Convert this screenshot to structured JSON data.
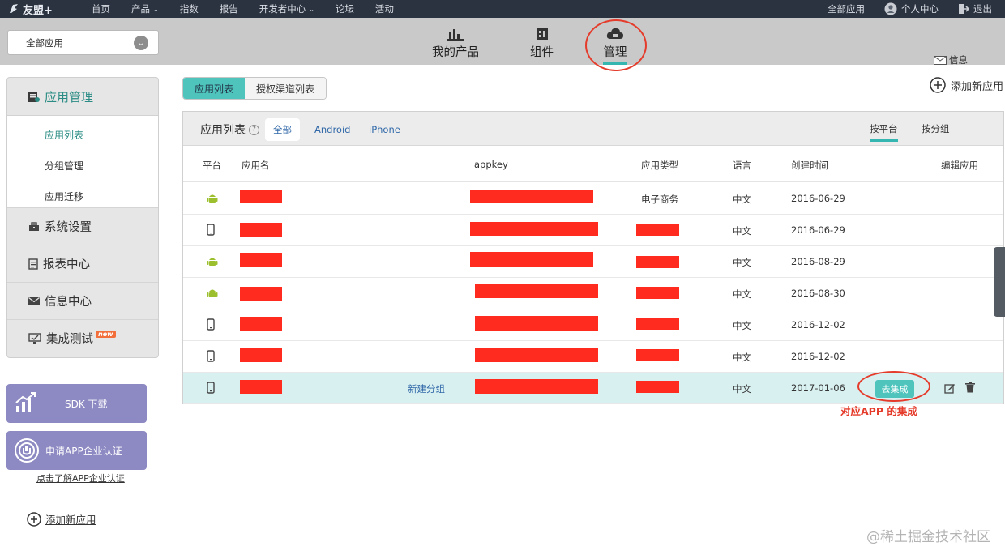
{
  "topnav": {
    "logo": "友盟+",
    "items": [
      {
        "label": "首页"
      },
      {
        "label": "产品",
        "caret": "⌄"
      },
      {
        "label": "指数"
      },
      {
        "label": "报告"
      },
      {
        "label": "开发者中心",
        "caret": "⌄"
      },
      {
        "label": "论坛"
      },
      {
        "label": "活动"
      }
    ],
    "right": {
      "all_apps": "全部应用",
      "personal_center": "个人中心",
      "logout": "退出"
    }
  },
  "subbar": {
    "app_select_value": "全部应用",
    "tabs": {
      "products": "我的产品",
      "components": "组件",
      "manage": "管理"
    },
    "message": "信息"
  },
  "sidebar": {
    "header": "应用管理",
    "subitems": [
      "应用列表",
      "分组管理",
      "应用迁移"
    ],
    "sections": [
      "系统设置",
      "报表中心",
      "信息中心",
      "集成测试"
    ],
    "new_badge": "new",
    "sdk_download": "SDK 下载",
    "enterprise_cert": "申请APP企业认证",
    "cert_link": "点击了解APP企业认证",
    "add_app": "添加新应用"
  },
  "main": {
    "segments": [
      "应用列表",
      "授权渠道列表"
    ],
    "add_app": "添加新应用",
    "panel": {
      "title": "应用列表",
      "help": "?",
      "filters": [
        "全部",
        "Android",
        "iPhone"
      ],
      "sorts": [
        "按平台",
        "按分组"
      ],
      "columns": {
        "platform": "平台",
        "app_name": "应用名",
        "appkey": "appkey",
        "app_type": "应用类型",
        "language": "语言",
        "created": "创建时间",
        "edit": "编辑应用"
      },
      "rows": [
        {
          "platform": "android",
          "type": "电子商务",
          "lang": "中文",
          "date": "2016-06-29"
        },
        {
          "platform": "iphone",
          "type": "",
          "lang": "中文",
          "date": "2016-06-29"
        },
        {
          "platform": "android",
          "type": "",
          "lang": "中文",
          "date": "2016-08-29"
        },
        {
          "platform": "android",
          "type": "",
          "lang": "中文",
          "date": "2016-08-30"
        },
        {
          "platform": "iphone",
          "type": "",
          "lang": "中文",
          "date": "2016-12-02"
        },
        {
          "platform": "iphone",
          "type": "",
          "lang": "中文",
          "date": "2016-12-02"
        },
        {
          "platform": "iphone",
          "type": "",
          "lang": "中文",
          "date": "2017-01-06",
          "group_link": "新建分组",
          "integrate": "去集成"
        }
      ]
    },
    "annotation": "对应APP 的集成"
  },
  "watermark": "@稀土掘金技术社区",
  "colors": {
    "accent": "#36b6b0",
    "redaction": "#ff2b1f",
    "annotation": "#e53b2b",
    "sidebar_button": "#8d89c2"
  }
}
